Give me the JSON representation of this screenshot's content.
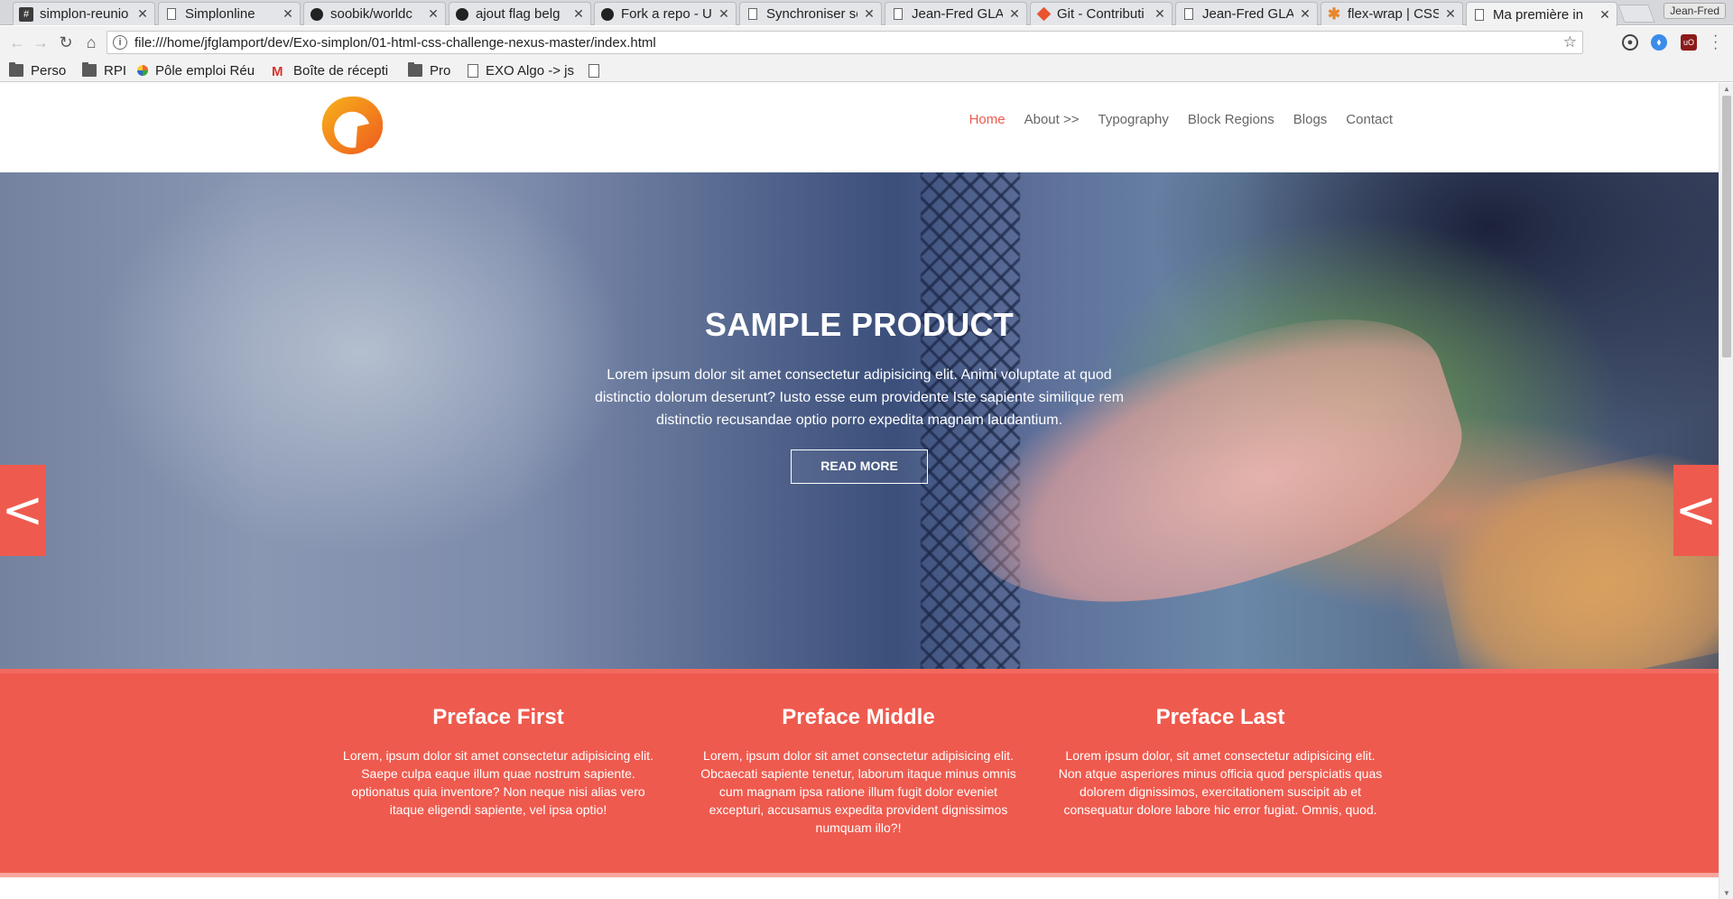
{
  "browser": {
    "tabs": [
      {
        "title": "simplon-reunio",
        "icon": "hash-icon",
        "active": false
      },
      {
        "title": "Simplonline",
        "icon": "page-icon",
        "active": false
      },
      {
        "title": "soobik/worldc",
        "icon": "github-icon",
        "active": false
      },
      {
        "title": "ajout flag belg",
        "icon": "github-icon",
        "active": false
      },
      {
        "title": "Fork a repo - Us",
        "icon": "github-icon",
        "active": false
      },
      {
        "title": "Synchroniser so",
        "icon": "page-icon",
        "active": false
      },
      {
        "title": "Jean-Fred GLA",
        "icon": "page-icon",
        "active": false
      },
      {
        "title": "Git - Contributi",
        "icon": "git-icon",
        "active": false
      },
      {
        "title": "Jean-Fred GLA",
        "icon": "page-icon",
        "active": false
      },
      {
        "title": "flex-wrap | CSS",
        "icon": "asterisk-icon",
        "active": false
      },
      {
        "title": "Ma première in",
        "icon": "page-icon",
        "active": true
      }
    ],
    "profile": "Jean-Fred",
    "url": "file:///home/jfglamport/dev/Exo-simplon/01-html-css-challenge-nexus-master/index.html",
    "bookmarks": [
      {
        "label": "Perso",
        "icon": "folder-icon"
      },
      {
        "label": "RPI",
        "icon": "folder-icon"
      },
      {
        "label": "Pôle emploi Réu",
        "icon": "pole-emploi-icon"
      },
      {
        "label": "Boîte de récepti",
        "icon": "gmail-icon"
      },
      {
        "label": "Pro",
        "icon": "folder-icon"
      },
      {
        "label": "EXO Algo -> js",
        "icon": "page-icon"
      },
      {
        "label": "",
        "icon": "page-icon"
      }
    ]
  },
  "site": {
    "nav": [
      {
        "label": "Home",
        "active": true
      },
      {
        "label": "About >>",
        "active": false
      },
      {
        "label": "Typography",
        "active": false
      },
      {
        "label": "Block Regions",
        "active": false
      },
      {
        "label": "Blogs",
        "active": false
      },
      {
        "label": "Contact",
        "active": false
      }
    ],
    "hero": {
      "title": "SAMPLE PRODUCT",
      "text": "Lorem ipsum dolor sit amet consectetur adipisicing elit. Animi voluptate at quod distinctio dolorum deserunt? Iusto esse eum providente Iste sapiente similique rem distinctio recusandae optio porro expedita magnam laudantium.",
      "button": "READ MORE",
      "prev_arrow": "<",
      "next_arrow": "<"
    },
    "preface": [
      {
        "title": "Preface First",
        "text": "Lorem, ipsum dolor sit amet consectetur adipisicing elit. Saepe culpa eaque illum quae nostrum sapiente. optionatus quia inventore? Non neque nisi alias vero itaque eligendi sapiente, vel ipsa optio!"
      },
      {
        "title": "Preface Middle",
        "text": "Lorem, ipsum dolor sit amet consectetur adipisicing elit. Obcaecati sapiente tenetur, laborum itaque minus omnis cum magnam ipsa ratione illum fugit dolor eveniet excepturi, accusamus expedita provident dignissimos numquam illo?!"
      },
      {
        "title": "Preface Last",
        "text": "Lorem ipsum dolor, sit amet consectetur adipisicing elit. Non atque asperiores minus officia quod perspiciatis quas dolorem dignissimos, exercitationem suscipit ab et consequatur dolore labore hic error fugiat. Omnis, quod."
      }
    ],
    "colors": {
      "accent": "#ef5a4e",
      "logo_orange": "#f39a1e"
    }
  }
}
